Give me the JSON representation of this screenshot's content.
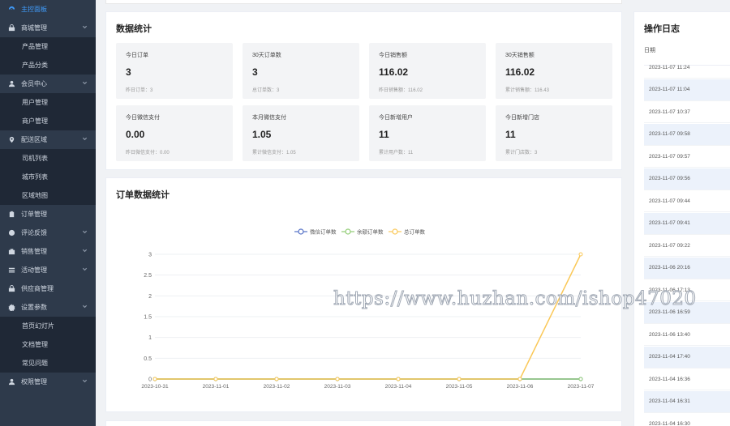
{
  "sidebar": {
    "items": [
      {
        "type": "group",
        "label": "主控面板",
        "icon": "dashboard-icon",
        "active": true,
        "chevron": false
      },
      {
        "type": "group",
        "label": "商城管理",
        "icon": "shop-icon",
        "chevron": true
      },
      {
        "type": "sub",
        "label": "产品管理"
      },
      {
        "type": "sub",
        "label": "产品分类"
      },
      {
        "type": "group",
        "label": "会员中心",
        "icon": "user-icon",
        "chevron": true
      },
      {
        "type": "sub",
        "label": "用户管理"
      },
      {
        "type": "sub",
        "label": "商户管理"
      },
      {
        "type": "group",
        "label": "配送区域",
        "icon": "location-icon",
        "chevron": true
      },
      {
        "type": "sub",
        "label": "司机列表"
      },
      {
        "type": "sub",
        "label": "城市列表"
      },
      {
        "type": "sub",
        "label": "区域地图"
      },
      {
        "type": "group",
        "label": "订单管理",
        "icon": "clipboard-icon",
        "chevron": false
      },
      {
        "type": "group",
        "label": "评论反馈",
        "icon": "comment-icon",
        "chevron": true
      },
      {
        "type": "group",
        "label": "销售管理",
        "icon": "sales-icon",
        "chevron": true
      },
      {
        "type": "group",
        "label": "活动管理",
        "icon": "activity-icon",
        "chevron": true
      },
      {
        "type": "group",
        "label": "供应商管理",
        "icon": "supplier-icon",
        "chevron": false
      },
      {
        "type": "group",
        "label": "设置参数",
        "icon": "gear-icon",
        "chevron": true
      },
      {
        "type": "sub",
        "label": "首页幻灯片"
      },
      {
        "type": "sub",
        "label": "文档管理"
      },
      {
        "type": "sub",
        "label": "常见问题"
      },
      {
        "type": "group",
        "label": "权限管理",
        "icon": "permission-icon",
        "chevron": true
      }
    ]
  },
  "stats": {
    "title": "数据统计",
    "boxes": [
      {
        "label": "今日订单",
        "value": "3",
        "sub": "昨日订单：3"
      },
      {
        "label": "30天订单数",
        "value": "3",
        "sub": "总订单数：3"
      },
      {
        "label": "今日销售额",
        "value": "116.02",
        "sub": "昨日销售额：116.02"
      },
      {
        "label": "30天销售额",
        "value": "116.02",
        "sub": "累计销售额：116.43"
      },
      {
        "label": "今日微信支付",
        "value": "0.00",
        "sub": "昨日微信支付：0.00"
      },
      {
        "label": "本月微信支付",
        "value": "1.05",
        "sub": "累计微信支付：1.05"
      },
      {
        "label": "今日新增用户",
        "value": "11",
        "sub": "累计用户数：11"
      },
      {
        "label": "今日新增门店",
        "value": "11",
        "sub": "累计门店数：3"
      }
    ]
  },
  "orders": {
    "title": "订单数据统计"
  },
  "chart_data": {
    "type": "line",
    "title": "订单数据统计",
    "x": [
      "2023-10-31",
      "2023-11-01",
      "2023-11-02",
      "2023-11-03",
      "2023-11-04",
      "2023-11-05",
      "2023-11-06",
      "2023-11-07"
    ],
    "series": [
      {
        "name": "微信订单数",
        "color": "#5470c6",
        "values": [
          0,
          0,
          0,
          0,
          0,
          0,
          0,
          0
        ]
      },
      {
        "name": "余额订单数",
        "color": "#91cc75",
        "values": [
          0,
          0,
          0,
          0,
          0,
          0,
          0,
          0
        ]
      },
      {
        "name": "总订单数",
        "color": "#fac858",
        "values": [
          0,
          0,
          0,
          0,
          0,
          0,
          0,
          3
        ]
      }
    ],
    "ylim": [
      0,
      3
    ],
    "yticks": [
      "0",
      "0.5",
      "1",
      "1.5",
      "2",
      "2.5",
      "3"
    ],
    "legend": "top-center",
    "grid": true
  },
  "log": {
    "title": "操作日志",
    "column": "日期",
    "rows": [
      "2023-11-07 11:24",
      "2023-11-07 11:04",
      "2023-11-07 10:37",
      "2023-11-07 09:58",
      "2023-11-07 09:57",
      "2023-11-07 09:56",
      "2023-11-07 09:44",
      "2023-11-07 09:41",
      "2023-11-07 09:22",
      "2023-11-06 20:16",
      "2023-11-06 17:13",
      "2023-11-06 16:59",
      "2023-11-06 13:40",
      "2023-11-04 17:40",
      "2023-11-04 16:36",
      "2023-11-04 16:31",
      "2023-11-04 16:30"
    ]
  },
  "watermark": "https://www.huzhan.com/ishop47020"
}
